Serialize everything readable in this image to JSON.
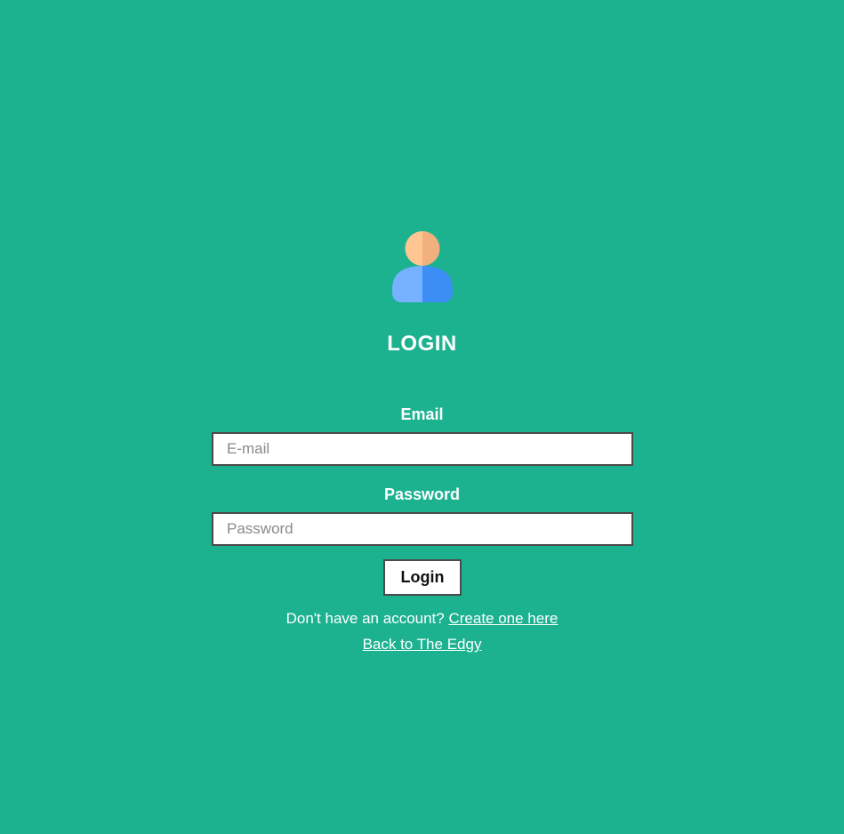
{
  "colors": {
    "background": "#1cb290",
    "avatar_head_light": "#ffc592",
    "avatar_head_dark": "#f0b17f",
    "avatar_body_light": "#76b2ff",
    "avatar_body_dark": "#3d8ff6"
  },
  "icons": {
    "avatar": "user-avatar-icon"
  },
  "login": {
    "title": "LOGIN",
    "email_label": "Email",
    "email_placeholder": "E-mail",
    "email_value": "",
    "password_label": "Password",
    "password_placeholder": "Password",
    "password_value": "",
    "button_label": "Login",
    "register_prompt": "Don't have an account?",
    "register_link": "Create one here",
    "back_link": "Back to The Edgy"
  }
}
